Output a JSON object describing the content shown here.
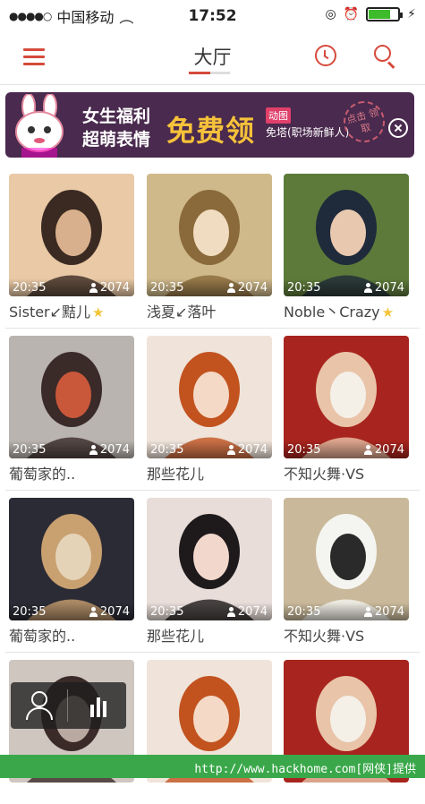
{
  "status": {
    "carrier": "中国移动",
    "time": "17:52",
    "signal_dots": "●●●●○",
    "battery_level": 0.8
  },
  "header": {
    "title": "大厅",
    "menu_icon": "menu-icon",
    "history_icon": "clock-icon",
    "search_icon": "search-icon"
  },
  "banner": {
    "line1": "女生福利",
    "line2": "超萌表情",
    "headline": "免费领",
    "tag": "动图",
    "subline": "免塔(职场新鲜人)",
    "stamp": "点击 领取",
    "close_icon": "close-icon",
    "colors": {
      "background": "#4a2a4e",
      "headline": "#f6c23a",
      "tag": "#e0406a"
    }
  },
  "cards": [
    {
      "duration": "20:35",
      "viewers": "2074",
      "title": "Sister↙黠儿",
      "star": true,
      "palette": [
        "#e9c9a6",
        "#3a2a22",
        "#d9b08d"
      ]
    },
    {
      "duration": "20:35",
      "viewers": "2074",
      "title": "浅夏↙落叶",
      "star": false,
      "palette": [
        "#cfb98a",
        "#8a6a3a",
        "#f0dcc0"
      ]
    },
    {
      "duration": "20:35",
      "viewers": "2074",
      "title": "Noble丶Crazy",
      "star": true,
      "palette": [
        "#5d7a3a",
        "#1f2a3a",
        "#e8c9b0"
      ]
    },
    {
      "duration": "20:35",
      "viewers": "2074",
      "title": "葡萄家的..",
      "star": false,
      "palette": [
        "#b9b4b0",
        "#3a2a28",
        "#c9573a"
      ]
    },
    {
      "duration": "20:35",
      "viewers": "2074",
      "title": "那些花儿",
      "star": false,
      "palette": [
        "#f0e4da",
        "#c2531f",
        "#f4d9c6"
      ]
    },
    {
      "duration": "20:35",
      "viewers": "2074",
      "title": "不知火舞·VS",
      "star": false,
      "palette": [
        "#a8241e",
        "#e9c4a8",
        "#f4f0e8"
      ]
    },
    {
      "duration": "20:35",
      "viewers": "2074",
      "title": "葡萄家的..",
      "star": false,
      "palette": [
        "#2b2b35",
        "#c9a070",
        "#e5d3b8"
      ]
    },
    {
      "duration": "20:35",
      "viewers": "2074",
      "title": "那些花儿",
      "star": false,
      "palette": [
        "#e8ddd8",
        "#1e1a1c",
        "#f2d8cc"
      ]
    },
    {
      "duration": "20:35",
      "viewers": "2074",
      "title": "不知火舞·VS",
      "star": false,
      "palette": [
        "#c9b99a",
        "#f4f4f0",
        "#2a2a2a"
      ]
    },
    {
      "duration": "",
      "viewers": "",
      "title": "",
      "star": false,
      "palette": [
        "#cfc6c0",
        "#3a2a28",
        "#b9a9a0"
      ]
    },
    {
      "duration": "",
      "viewers": "",
      "title": "",
      "star": false,
      "palette": [
        "#f0e4da",
        "#c2531f",
        "#f4d9c6"
      ]
    },
    {
      "duration": "",
      "viewers": "",
      "title": "",
      "star": false,
      "palette": [
        "#a8241e",
        "#e9c4a8",
        "#f4f0e8"
      ]
    }
  ],
  "floating_bar": {
    "user_icon": "user-icon",
    "chart_icon": "bar-chart-icon"
  },
  "footer": {
    "watermark": "http://www.hackhome.com[网侠]提供"
  }
}
